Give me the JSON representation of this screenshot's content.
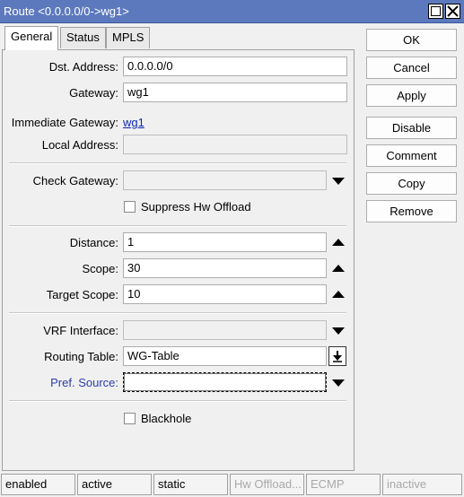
{
  "window": {
    "title": "Route <0.0.0.0/0->wg1>"
  },
  "tabs": [
    {
      "label": "General"
    },
    {
      "label": "Status"
    },
    {
      "label": "MPLS"
    }
  ],
  "form": {
    "dst_address": {
      "label": "Dst. Address:",
      "value": "0.0.0.0/0"
    },
    "gateway": {
      "label": "Gateway:",
      "value": "wg1"
    },
    "immediate_gateway": {
      "label": "Immediate Gateway:",
      "value": "wg1"
    },
    "local_address": {
      "label": "Local Address:",
      "value": ""
    },
    "check_gateway": {
      "label": "Check Gateway:",
      "value": ""
    },
    "suppress_hw_offload": {
      "label": "Suppress Hw Offload",
      "checked": false
    },
    "distance": {
      "label": "Distance:",
      "value": "1"
    },
    "scope": {
      "label": "Scope:",
      "value": "30"
    },
    "target_scope": {
      "label": "Target Scope:",
      "value": "10"
    },
    "vrf_interface": {
      "label": "VRF Interface:",
      "value": ""
    },
    "routing_table": {
      "label": "Routing Table:",
      "value": "WG-Table"
    },
    "pref_source": {
      "label": "Pref. Source:",
      "value": ""
    },
    "blackhole": {
      "label": "Blackhole",
      "checked": false
    }
  },
  "buttons": {
    "ok": "OK",
    "cancel": "Cancel",
    "apply": "Apply",
    "disable": "Disable",
    "comment": "Comment",
    "copy": "Copy",
    "remove": "Remove"
  },
  "status_bar": [
    {
      "text": "enabled",
      "dim": false
    },
    {
      "text": "active",
      "dim": false
    },
    {
      "text": "static",
      "dim": false
    },
    {
      "text": "Hw Offload...",
      "dim": true
    },
    {
      "text": "ECMP",
      "dim": true
    },
    {
      "text": "inactive",
      "dim": true
    }
  ],
  "colors": {
    "titlebar": "#5d79bd",
    "link": "#0b28b5",
    "pref_source_label": "#2b3ea7"
  }
}
